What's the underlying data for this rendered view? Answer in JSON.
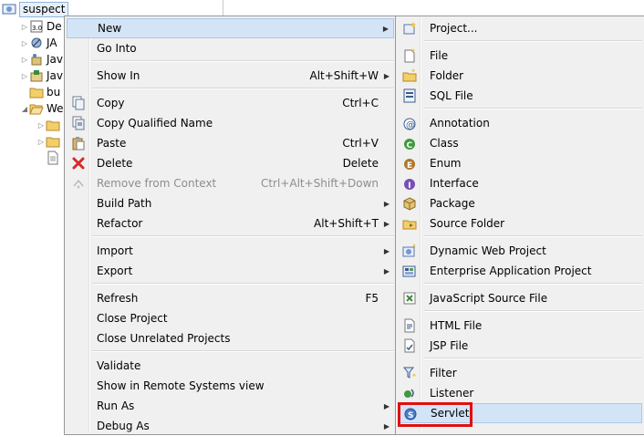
{
  "tree": {
    "root": "suspect",
    "items": [
      "De",
      "JA",
      "Jav",
      "Jav",
      "bu",
      "We"
    ]
  },
  "menu": {
    "items": [
      {
        "label": "New",
        "shortcut": "",
        "submenu": true
      },
      {
        "label": "Go Into",
        "shortcut": ""
      },
      {
        "label": "Show In",
        "shortcut": "Alt+Shift+W",
        "submenu": true
      },
      {
        "label": "Copy",
        "shortcut": "Ctrl+C"
      },
      {
        "label": "Copy Qualified Name",
        "shortcut": ""
      },
      {
        "label": "Paste",
        "shortcut": "Ctrl+V"
      },
      {
        "label": "Delete",
        "shortcut": "Delete"
      },
      {
        "label": "Remove from Context",
        "shortcut": "Ctrl+Alt+Shift+Down"
      },
      {
        "label": "Build Path",
        "shortcut": "",
        "submenu": true
      },
      {
        "label": "Refactor",
        "shortcut": "Alt+Shift+T",
        "submenu": true
      },
      {
        "label": "Import",
        "shortcut": "",
        "submenu": true
      },
      {
        "label": "Export",
        "shortcut": "",
        "submenu": true
      },
      {
        "label": "Refresh",
        "shortcut": "F5"
      },
      {
        "label": "Close Project",
        "shortcut": ""
      },
      {
        "label": "Close Unrelated Projects",
        "shortcut": ""
      },
      {
        "label": "Validate",
        "shortcut": ""
      },
      {
        "label": "Show in Remote Systems view",
        "shortcut": ""
      },
      {
        "label": "Run As",
        "shortcut": "",
        "submenu": true
      },
      {
        "label": "Debug As",
        "shortcut": "",
        "submenu": true
      }
    ]
  },
  "submenu": {
    "items": [
      "Project...",
      "File",
      "Folder",
      "SQL File",
      "Annotation",
      "Class",
      "Enum",
      "Interface",
      "Package",
      "Source Folder",
      "Dynamic Web Project",
      "Enterprise Application Project",
      "JavaScript Source File",
      "HTML File",
      "JSP File",
      "Filter",
      "Listener",
      "Servlet"
    ]
  },
  "colors": {
    "highlight": "#d4e4f7",
    "annotation_box": "#e01010",
    "menu_bg": "#f0f0f0"
  }
}
